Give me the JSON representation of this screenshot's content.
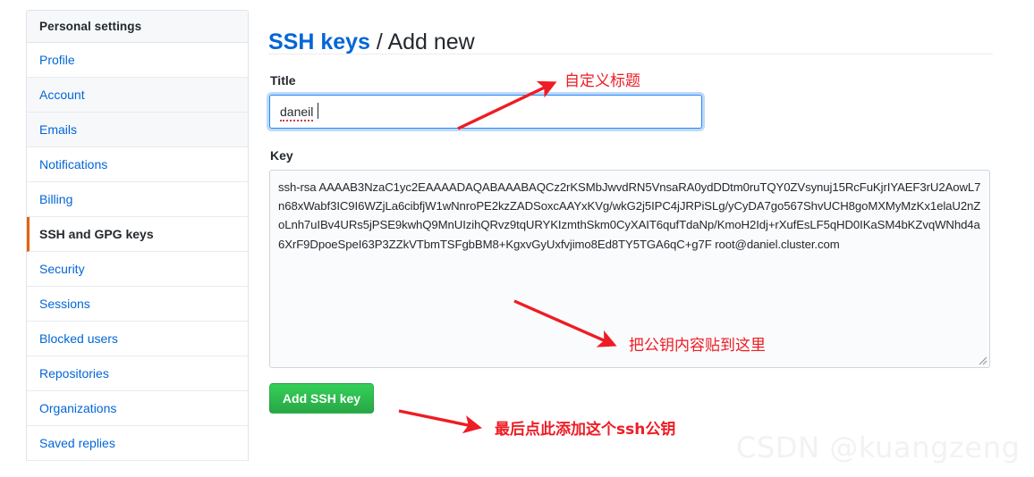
{
  "sidebar": {
    "header": "Personal settings",
    "items": [
      {
        "label": "Profile",
        "selected": false
      },
      {
        "label": "Account",
        "selected": false
      },
      {
        "label": "Emails",
        "selected": false
      },
      {
        "label": "Notifications",
        "selected": false
      },
      {
        "label": "Billing",
        "selected": false
      },
      {
        "label": "SSH and GPG keys",
        "selected": true
      },
      {
        "label": "Security",
        "selected": false
      },
      {
        "label": "Sessions",
        "selected": false
      },
      {
        "label": "Blocked users",
        "selected": false
      },
      {
        "label": "Repositories",
        "selected": false
      },
      {
        "label": "Organizations",
        "selected": false
      },
      {
        "label": "Saved replies",
        "selected": false
      }
    ]
  },
  "header": {
    "breadcrumb_link": "SSH keys",
    "breadcrumb_separator": " / ",
    "breadcrumb_current": "Add new"
  },
  "form": {
    "title_label": "Title",
    "title_value": "daneil",
    "title_placeholder": "",
    "key_label": "Key",
    "key_value": "ssh-rsa AAAAB3NzaC1yc2EAAAADAQABAAABAQCz2rKSMbJwvdRN5VnsaRA0ydDDtm0ruTQY0ZVsynuj15RcFuKjrIYAEF3rU2AowL7n68xWabf3IC9I6WZjLa6cibfjW1wNnroPE2kzZADSoxcAAYxKVg/wkG2j5IPC4jJRPiSLg/yCyDA7go567ShvUCH8goMXMyMzKx1elaU2nZoLnh7uIBv4URs5jPSE9kwhQ9MnUIzihQRvz9tqURYKIzmthSkm0CyXAIT6qufTdaNp/KmoH2Idj+rXufEsLF5qHD0IKaSM4bKZvqWNhd4a6XrF9DpoeSpeI63P3ZZkVTbmTSFgbBM8+KgxvGyUxfvjimo8Ed8TY5TGA6qC+g7F root@daniel.cluster.com",
    "key_placeholder": "",
    "submit_label": "Add SSH key",
    "submit_color": "#28a745"
  },
  "annotations": {
    "title_note": "自定义标题",
    "key_note": "把公钥内容贴到这里",
    "submit_note": "最后点此添加这个ssh公钥",
    "color": "#ee1c24"
  },
  "watermark": {
    "text": "CSDN @kuangzeng"
  }
}
